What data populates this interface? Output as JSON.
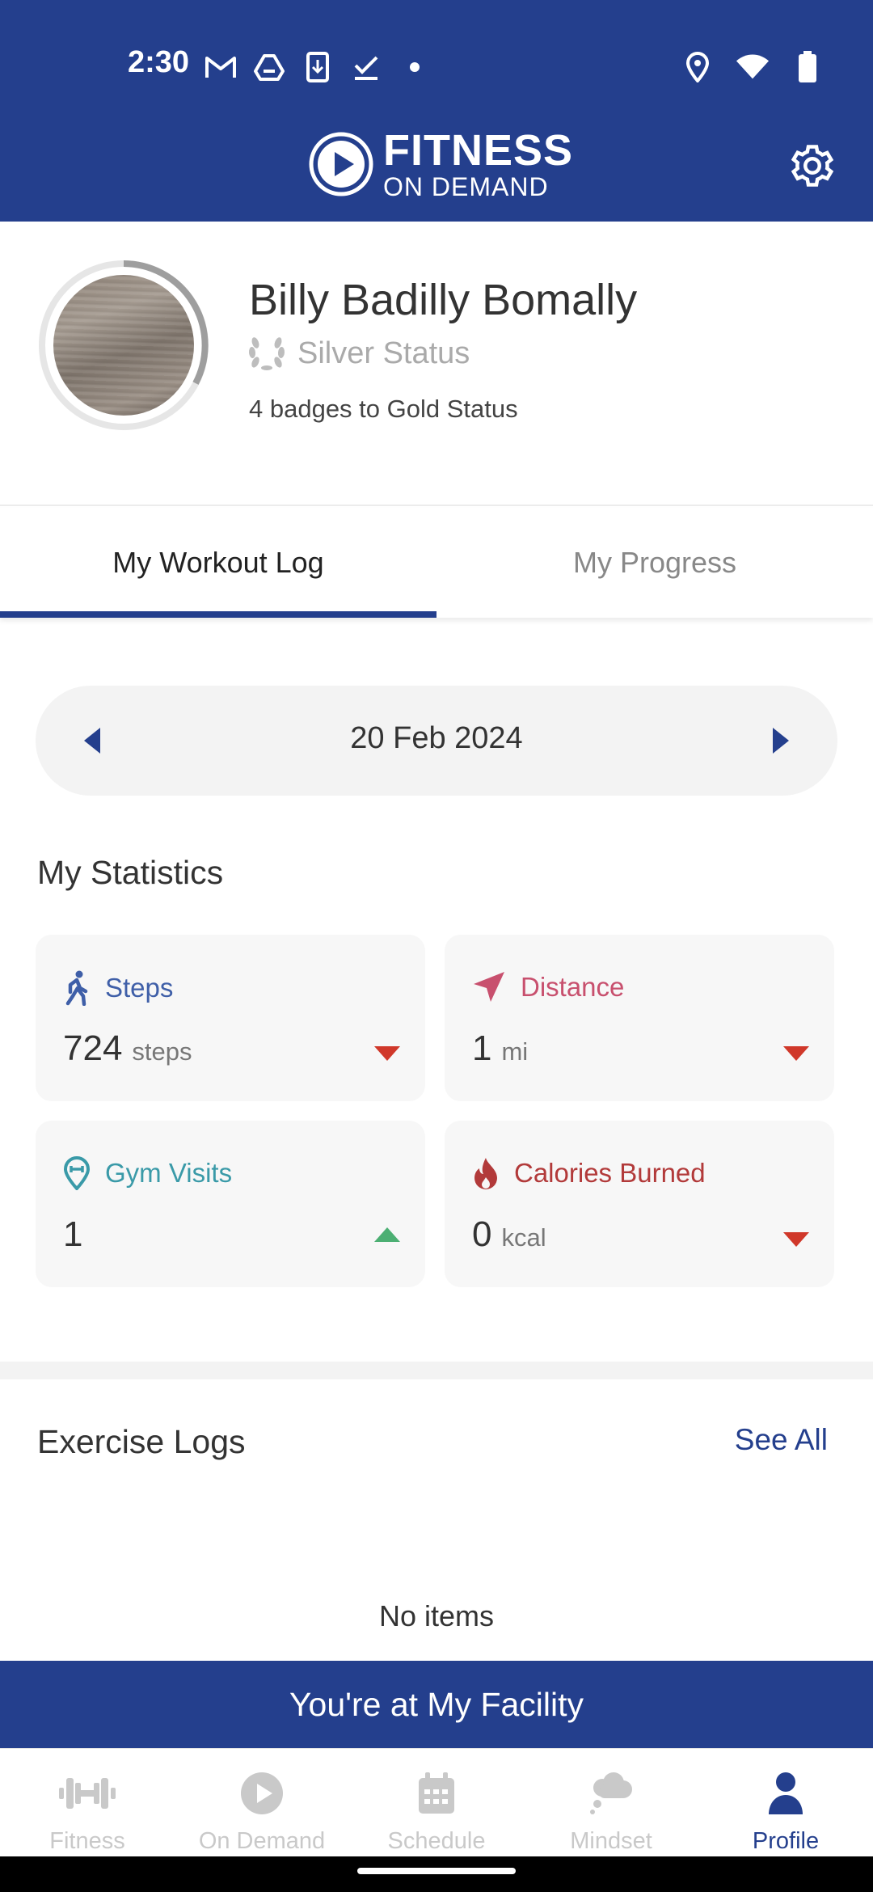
{
  "status_bar": {
    "time": "2:30",
    "left_icons": [
      "gmail-icon",
      "drive-icon",
      "download-icon",
      "check-icon",
      "dot-icon"
    ],
    "right_icons": [
      "location-icon",
      "wifi-icon",
      "battery-icon"
    ]
  },
  "header": {
    "logo_line1": "FITNESS",
    "logo_line2": "ON DEMAND",
    "settings_icon": "gear-icon"
  },
  "profile": {
    "name": "Billy Badilly Bomally",
    "status": "Silver Status",
    "badges_text": "4 badges to Gold Status"
  },
  "tabs": [
    {
      "label": "My Workout Log",
      "active": true
    },
    {
      "label": "My Progress",
      "active": false
    }
  ],
  "date_selector": {
    "date": "20 Feb 2024"
  },
  "statistics": {
    "title": "My Statistics",
    "cards": [
      {
        "label": "Steps",
        "value": "724",
        "unit": "steps",
        "trend": "down",
        "color": "#3f5fa8",
        "icon": "walking-icon"
      },
      {
        "label": "Distance",
        "value": "1",
        "unit": "mi",
        "trend": "down",
        "color": "#c8506e",
        "icon": "navigation-arrow-icon"
      },
      {
        "label": "Gym Visits",
        "value": "1",
        "unit": "",
        "trend": "up",
        "color": "#3a9aa8",
        "icon": "gym-location-icon"
      },
      {
        "label": "Calories Burned",
        "value": "0",
        "unit": "kcal",
        "trend": "down",
        "color": "#b23a3a",
        "icon": "flame-icon"
      }
    ]
  },
  "exercise_logs": {
    "title": "Exercise Logs",
    "see_all": "See All",
    "empty_text": "No items"
  },
  "facility_banner": "You're at My Facility",
  "bottom_nav": [
    {
      "label": "Fitness",
      "icon": "dumbbell-icon",
      "active": false
    },
    {
      "label": "On Demand",
      "icon": "play-circle-icon",
      "active": false
    },
    {
      "label": "Schedule",
      "icon": "calendar-icon",
      "active": false
    },
    {
      "label": "Mindset",
      "icon": "thought-cloud-icon",
      "active": false
    },
    {
      "label": "Profile",
      "icon": "person-icon",
      "active": true
    }
  ],
  "colors": {
    "brand": "#243f8d",
    "trend_down": "#d0382a",
    "trend_up": "#4caf73"
  }
}
